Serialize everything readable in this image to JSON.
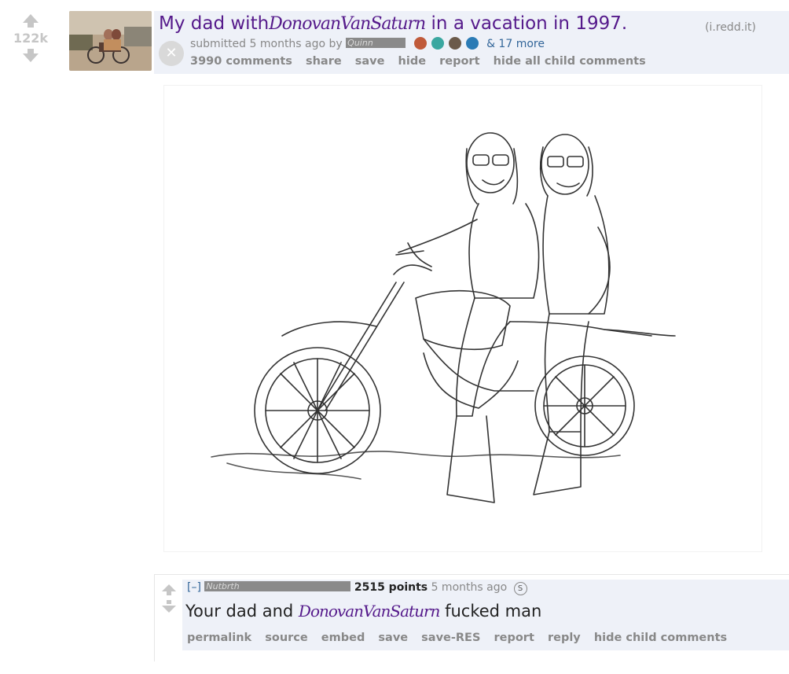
{
  "post": {
    "score": "122k",
    "title_before": "My dad with",
    "title_name": "DonovanVanSaturn",
    "title_after": " in a vacation in 1997.",
    "domain": "(i.redd.it)",
    "submitted_prefix": "submitted 5 months ago by",
    "username": "Quinn",
    "more_awards": "& 17 more",
    "close_glyph": "✕",
    "buttons": [
      "3990 comments",
      "share",
      "save",
      "hide",
      "report",
      "hide all child comments"
    ],
    "award_colors": [
      "#c05a3a",
      "#3aa7a0",
      "#6b5a4a",
      "#2b7bb5"
    ]
  },
  "comment": {
    "collapse": "[–]",
    "username": "Nutbrth",
    "points": "2515 points",
    "time": "5 months ago",
    "coin": "S",
    "body_before": "Your dad and ",
    "body_name": "DonovanVanSaturn",
    "body_after": " fucked man",
    "buttons": [
      "permalink",
      "source",
      "embed",
      "save",
      "save-RES",
      "report",
      "reply",
      "hide child comments"
    ]
  },
  "colors": {
    "title": "#551a8b",
    "link": "#336699",
    "muted": "#888888",
    "header_bg": "#eef1f8"
  }
}
